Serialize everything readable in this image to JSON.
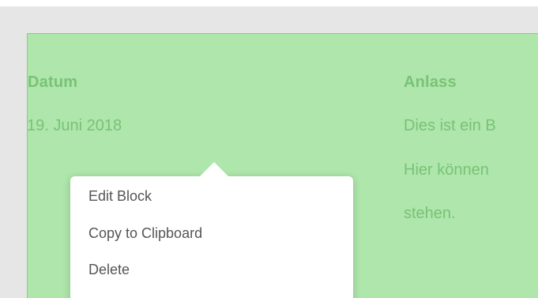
{
  "block": {
    "left_column": {
      "heading": "Datum",
      "value": "19. Juni 2018"
    },
    "right_column": {
      "heading": "Anlass",
      "lines": [
        "Dies ist ein B",
        "Hier können",
        "stehen."
      ]
    }
  },
  "context_menu": {
    "items": [
      {
        "label": "Edit Block"
      },
      {
        "label": "Copy to Clipboard"
      },
      {
        "label": "Delete"
      }
    ]
  },
  "colors": {
    "block_background": "#aee6ab",
    "block_text": "#79c276",
    "menu_background": "#ffffff",
    "menu_text": "#555555",
    "frame_background": "#e6e6e6"
  }
}
